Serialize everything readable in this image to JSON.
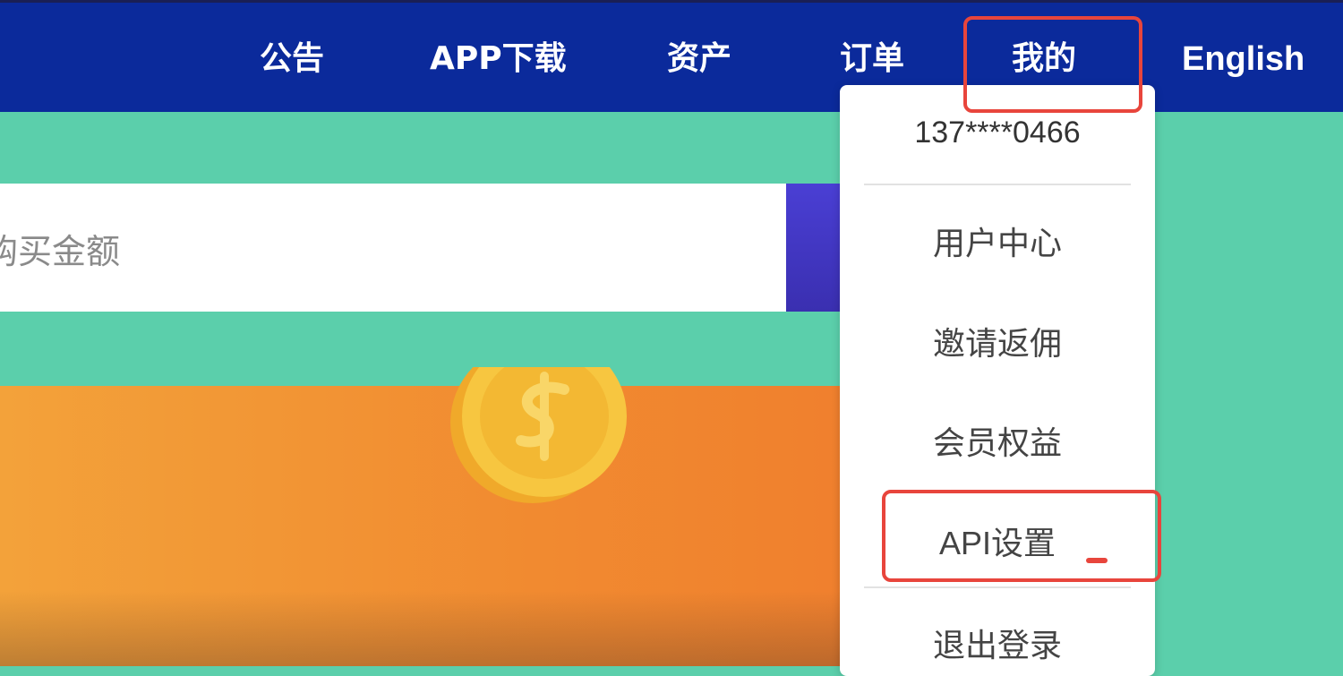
{
  "nav": {
    "items": [
      {
        "label": "公告"
      },
      {
        "label": "APP下载"
      },
      {
        "label": "资产"
      },
      {
        "label": "订单"
      },
      {
        "label": "我的"
      },
      {
        "label": "English"
      }
    ]
  },
  "search": {
    "placeholder": "购买金额"
  },
  "dropdown": {
    "phone": "137****0466",
    "items": [
      {
        "label": "用户中心"
      },
      {
        "label": "邀请返佣"
      },
      {
        "label": "会员权益"
      },
      {
        "label": "API设置"
      },
      {
        "label": "退出登录"
      }
    ]
  },
  "colors": {
    "nav_bg": "#0b2a9b",
    "teal": "#5bcfab",
    "highlight": "#e8453c",
    "banner": "#f18a30"
  }
}
